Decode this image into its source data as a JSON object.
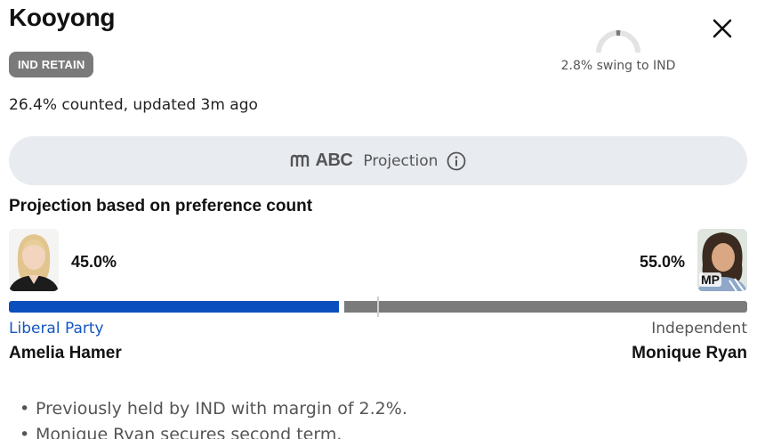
{
  "electorate": {
    "name": "Kooyong",
    "status_badge": "IND RETAIN"
  },
  "swing": {
    "text": "2.8% swing to IND",
    "percent": 2.8,
    "party": "IND"
  },
  "count": {
    "text": "26.4% counted, updated 3m ago"
  },
  "projection": {
    "logo_text": "ABC",
    "label": "Projection",
    "icon": "info-icon"
  },
  "preference": {
    "title": "Projection based on preference count",
    "candidates": [
      {
        "name": "Amelia Hamer",
        "party": "Liberal Party",
        "percent_text": "45.0%",
        "percent": 45.0,
        "color": "#0a4fbd"
      },
      {
        "name": "Monique Ryan",
        "party": "Independent",
        "percent_text": "55.0%",
        "percent": 55.0,
        "color": "#7b7b7b",
        "badge": "MP"
      }
    ]
  },
  "notes": [
    "Previously held by IND with margin of 2.2%.",
    "Monique Ryan secures second term."
  ],
  "icons": {
    "close": "close-icon",
    "info": "info-icon",
    "abc": "abc-logo-icon"
  }
}
